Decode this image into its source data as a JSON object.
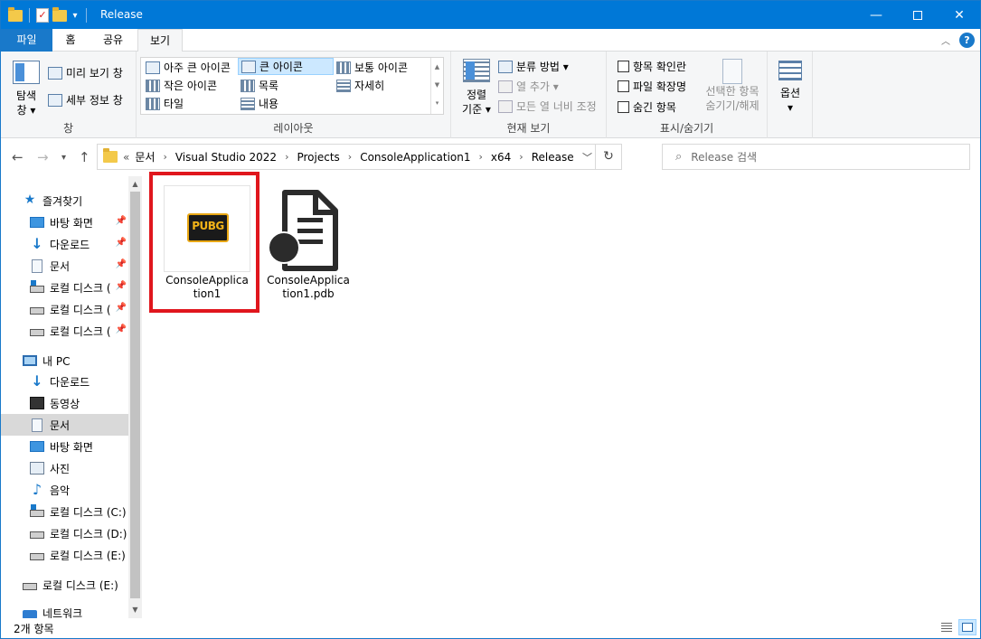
{
  "window": {
    "title": "Release",
    "minimize_glyph": "—",
    "close_glyph": "✕"
  },
  "ribbon_tabs": {
    "file": "파일",
    "home": "홈",
    "share": "공유",
    "view": "보기"
  },
  "ribbon": {
    "pane_group": {
      "nav_pane_line1": "탐색",
      "nav_pane_line2": "창 ▾",
      "preview_pane": "미리 보기 창",
      "details_pane": "세부 정보 창",
      "label": "창"
    },
    "layout_group": {
      "items": [
        "아주 큰 아이콘",
        "큰 아이콘",
        "보통 아이콘",
        "작은 아이콘",
        "목록",
        "자세히",
        "타일",
        "내용"
      ],
      "selected": "큰 아이콘",
      "label": "레이아웃"
    },
    "current_view_group": {
      "sort_line1": "정렬",
      "sort_line2": "기준 ▾",
      "group_by": "분류 방법 ▾",
      "add_columns": "열 추가 ▾",
      "fit_columns": "모든 열 너비 조정",
      "label": "현재 보기"
    },
    "show_hide_group": {
      "item_checkboxes": "항목 확인란",
      "file_extensions": "파일 확장명",
      "hidden_items": "숨긴 항목",
      "hide_selected_line1": "선택한 항목",
      "hide_selected_line2": "숨기기/해제",
      "label": "표시/숨기기"
    },
    "options": {
      "label": "옵션",
      "drop": "▾"
    }
  },
  "address": {
    "overflow": "«",
    "crumbs": [
      "문서",
      "Visual Studio 2022",
      "Projects",
      "ConsoleApplication1",
      "x64",
      "Release"
    ],
    "search_placeholder": "Release 검색"
  },
  "nav_pane": {
    "items": [
      {
        "label": "즐겨찾기",
        "icon": "star-icon"
      },
      {
        "label": "바탕 화면",
        "icon": "desktop-icon",
        "pinned": true
      },
      {
        "label": "다운로드",
        "icon": "download-icon",
        "pinned": true
      },
      {
        "label": "문서",
        "icon": "documents-icon",
        "pinned": true
      },
      {
        "label": "로컬 디스크 (",
        "icon": "drive-icon",
        "pinned": true
      },
      {
        "label": "로컬 디스크 (",
        "icon": "drive-icon",
        "pinned": true
      },
      {
        "label": "로컬 디스크 (",
        "icon": "drive-icon",
        "pinned": true
      },
      {
        "label": "내 PC",
        "icon": "pc-icon"
      },
      {
        "label": "다운로드",
        "icon": "download-icon"
      },
      {
        "label": "동영상",
        "icon": "video-icon"
      },
      {
        "label": "문서",
        "icon": "documents-icon",
        "selected": true
      },
      {
        "label": "바탕 화면",
        "icon": "desktop-icon"
      },
      {
        "label": "사진",
        "icon": "pictures-icon"
      },
      {
        "label": "음악",
        "icon": "music-icon"
      },
      {
        "label": "로컬 디스크 (C:)",
        "icon": "drive-icon"
      },
      {
        "label": "로컬 디스크 (D:)",
        "icon": "drive-icon"
      },
      {
        "label": "로컬 디스크 (E:)",
        "icon": "drive-icon"
      },
      {
        "label": "로컬 디스크 (E:)",
        "icon": "drive-icon"
      },
      {
        "label": "네트워크",
        "icon": "network-icon"
      }
    ]
  },
  "files": [
    {
      "name": "ConsoleApplication1",
      "type": "exe",
      "icon": "pubg-app-icon",
      "badge_text": "PUBG",
      "highlighted": true
    },
    {
      "name": "ConsoleApplication1.pdb",
      "type": "pdb",
      "icon": "pdb-file-icon"
    }
  ],
  "status_bar": {
    "item_count": "2개 항목"
  },
  "colors": {
    "titlebar": "#0078d7",
    "file_tab": "#1979ca",
    "highlight_box": "#e0161d",
    "pubg_gold": "#f2b318"
  }
}
